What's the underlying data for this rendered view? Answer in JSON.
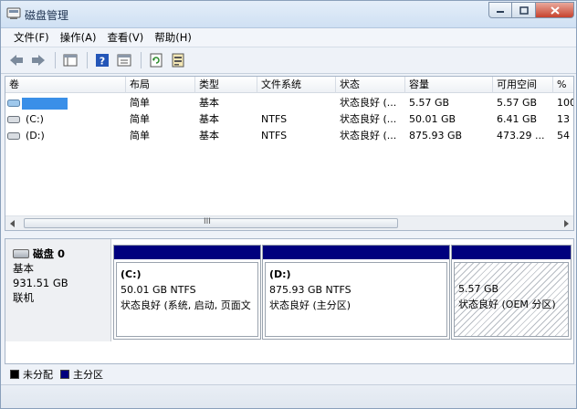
{
  "window": {
    "title": "磁盘管理"
  },
  "colors": {
    "primary_partition": "#00007e",
    "unallocated": "#000000",
    "selection": "#3a8fe8"
  },
  "menu": [
    {
      "label": "文件(F)"
    },
    {
      "label": "操作(A)"
    },
    {
      "label": "查看(V)"
    },
    {
      "label": "帮助(H)"
    }
  ],
  "toolbar": [
    "back-arrow-icon",
    "forward-arrow-icon",
    "console-tree-icon",
    "help-icon",
    "properties-icon",
    "refresh-icon",
    "rescan-disk-icon"
  ],
  "volume_table": {
    "columns": [
      "卷",
      "布局",
      "类型",
      "文件系统",
      "状态",
      "容量",
      "可用空间",
      "%"
    ],
    "rows": [
      {
        "volume": "",
        "layout": "简单",
        "type": "基本",
        "fs": "",
        "status": "状态良好 (...",
        "capacity": "5.57 GB",
        "free": "5.57 GB",
        "pct": "100"
      },
      {
        "volume": "(C:)",
        "layout": "简单",
        "type": "基本",
        "fs": "NTFS",
        "status": "状态良好 (...",
        "capacity": "50.01 GB",
        "free": "6.41 GB",
        "pct": "13"
      },
      {
        "volume": "(D:)",
        "layout": "简单",
        "type": "基本",
        "fs": "NTFS",
        "status": "状态良好 (...",
        "capacity": "875.93 GB",
        "free": "473.29 ...",
        "pct": "54"
      }
    ],
    "scroll_mark": "III"
  },
  "disk": {
    "name": "磁盘 0",
    "type": "基本",
    "size": "931.51 GB",
    "state": "联机",
    "partitions": [
      {
        "name": "(C:)",
        "size": "50.01 GB NTFS",
        "status": "状态良好 (系统, 启动, 页面文"
      },
      {
        "name": "(D:)",
        "size": "875.93 GB NTFS",
        "status": "状态良好 (主分区)"
      },
      {
        "name": "",
        "size": "5.57 GB",
        "status": "状态良好 (OEM 分区)"
      }
    ]
  },
  "legend": [
    {
      "label": "未分配",
      "color": "#000000"
    },
    {
      "label": "主分区",
      "color": "#00007e"
    }
  ]
}
